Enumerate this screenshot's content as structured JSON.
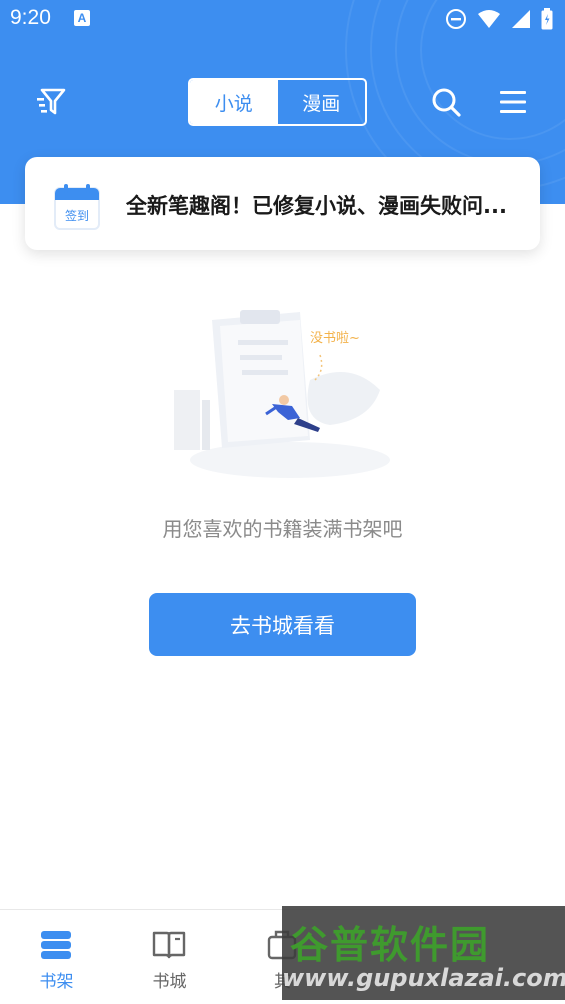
{
  "status_bar": {
    "time": "9:20",
    "badge": "A"
  },
  "toolbar": {
    "tabs": [
      {
        "label": "小说",
        "active": true
      },
      {
        "label": "漫画",
        "active": false
      }
    ],
    "filter_icon": "filter-icon",
    "search_icon": "search-icon",
    "menu_icon": "menu-icon"
  },
  "notice": {
    "checkin_label": "签到",
    "text": "全新笔趣阁！已修复小说、漫画失败问..."
  },
  "empty_state": {
    "bubble": "没书啦~",
    "message": "用您喜欢的书籍装满书架吧",
    "button_label": "去书城看看"
  },
  "bottom_nav": {
    "items": [
      {
        "label": "书架",
        "icon": "bookshelf-icon",
        "active": true
      },
      {
        "label": "书城",
        "icon": "book-open-icon",
        "active": false
      },
      {
        "label": "其",
        "icon": "bag-icon",
        "active": false
      }
    ]
  },
  "watermark": {
    "logo": "谷普软件园",
    "url": "www.gupuxlazai.com"
  },
  "colors": {
    "primary": "#3d8ef0",
    "text_muted": "#8a8a8a",
    "notice_text": "#1a1a1a"
  }
}
